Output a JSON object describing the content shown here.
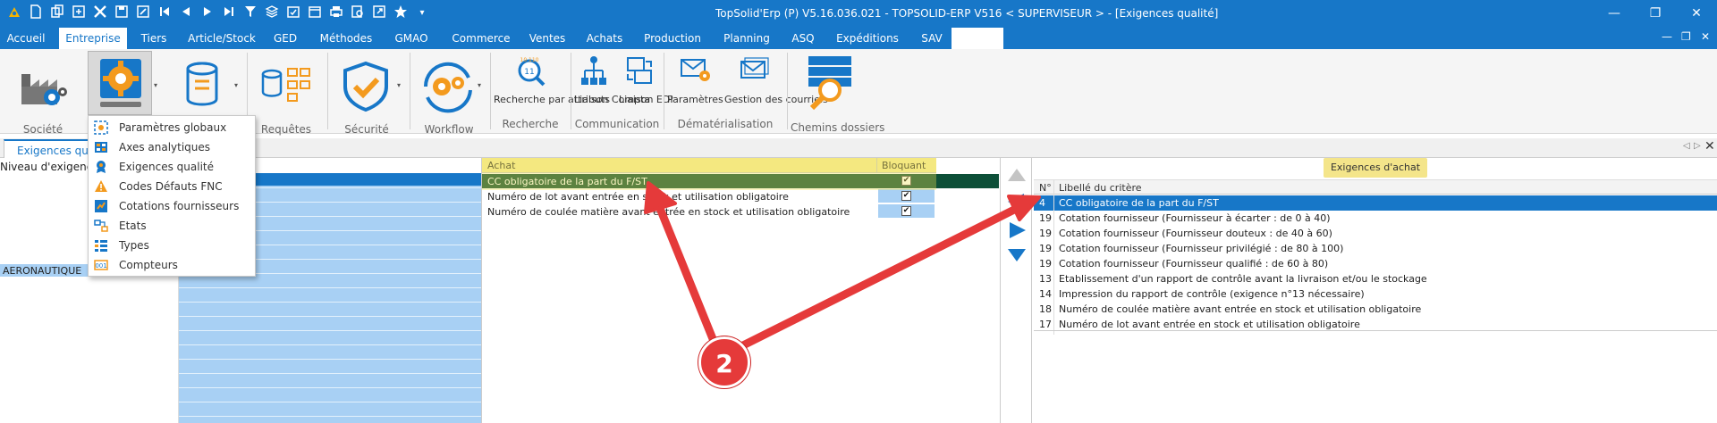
{
  "titlebar": {
    "title": "TopSolid'Erp (P)   V5.16.036.021  -  TOPSOLID-ERP V516   <  SUPERVISEUR > - [Exigences qualité]",
    "min": "—",
    "restore": "❐",
    "close": "✕"
  },
  "menubar": {
    "tabs": [
      "Accueil",
      "Entreprise",
      "Tiers",
      "Article/Stock",
      "GED",
      "Méthodes",
      "GMAO",
      "Commerce",
      "Ventes",
      "Achats",
      "Production",
      "Planning",
      "ASQ",
      "Expéditions",
      "SAV"
    ],
    "active_index": 1,
    "window_controls": {
      "min": "—",
      "restore": "❐",
      "close": "✕"
    }
  },
  "ribbon": {
    "buttons": {
      "societe": "Société",
      "requetes": "Requêtes",
      "securite": "Sécurité",
      "workflow": "Workflow",
      "recherche_attr": "Recherche par attributs",
      "liaison_compta": "Liaison Compta",
      "liaison_edi": "Liaison EDI",
      "parametres": "Paramètres",
      "gestion_courriels": "Gestion des courriels",
      "chemins": "Chemins dossiers"
    },
    "groups": {
      "recherche": "Recherche",
      "communication": "Communication",
      "dematerialisation": "Dématérialisation",
      "chemins": "Chemins dossiers"
    },
    "badge_text": "10\n11"
  },
  "dropdown": {
    "items": [
      {
        "label": "Paramètres globaux",
        "icon": "params-icon"
      },
      {
        "label": "Axes analytiques",
        "icon": "axes-icon"
      },
      {
        "label": "Exigences qualité",
        "icon": "quality-icon"
      },
      {
        "label": "Codes Défauts FNC",
        "icon": "warning-icon"
      },
      {
        "label": "Cotations fournisseurs",
        "icon": "cotation-icon"
      },
      {
        "label": "Etats",
        "icon": "etats-icon"
      },
      {
        "label": "Types",
        "icon": "types-icon"
      },
      {
        "label": "Compteurs",
        "icon": "counter-icon"
      }
    ]
  },
  "doc_tab": {
    "label": "Exigences quali"
  },
  "left": {
    "header": "Niveau d'exigence",
    "selected": "AERONAUTIQUE"
  },
  "achat_grid": {
    "col_achat": "Achat",
    "col_bloquant": "Bloquant",
    "rows": [
      {
        "label": "CC obligatoire de la part du F/ST",
        "checked": "✔"
      },
      {
        "label": "Numéro de lot avant entrée en stock et utilisation obligatoire",
        "checked": "✔"
      },
      {
        "label": "Numéro de coulée matière avant entrée en stock et utilisation obligatoire",
        "checked": "✔"
      }
    ]
  },
  "criteria": {
    "title": "Exigences d'achat",
    "col_n": "N°",
    "col_label": "Libellé du critère",
    "rows": [
      {
        "n": "4",
        "label": "CC obligatoire de la part du F/ST"
      },
      {
        "n": "19",
        "label": "Cotation fournisseur (Fournisseur à écarter : de 0 à 40)"
      },
      {
        "n": "19",
        "label": "Cotation fournisseur (Fournisseur douteux : de 40 à 60)"
      },
      {
        "n": "19",
        "label": "Cotation fournisseur (Fournisseur privilégié : de 80 à 100)"
      },
      {
        "n": "19",
        "label": "Cotation fournisseur (Fournisseur qualifié : de 60 à 80)"
      },
      {
        "n": "13",
        "label": "Etablissement d'un rapport de contrôle avant la livraison et/ou le stockage"
      },
      {
        "n": "14",
        "label": "Impression du rapport de contrôle (exigence n°13 nécessaire)"
      },
      {
        "n": "18",
        "label": "Numéro de coulée matière avant entrée en stock et utilisation obligatoire"
      },
      {
        "n": "17",
        "label": "Numéro de lot avant entrée en stock et utilisation obligatoire"
      }
    ]
  },
  "annotation": {
    "badge": "2"
  },
  "colors": {
    "accent": "#1777c8",
    "selection_dark": "#0d4f38",
    "highlight_yellow": "#f4e58a",
    "light_blue": "#a8d0f4",
    "annotation_red": "#e53a3a"
  }
}
